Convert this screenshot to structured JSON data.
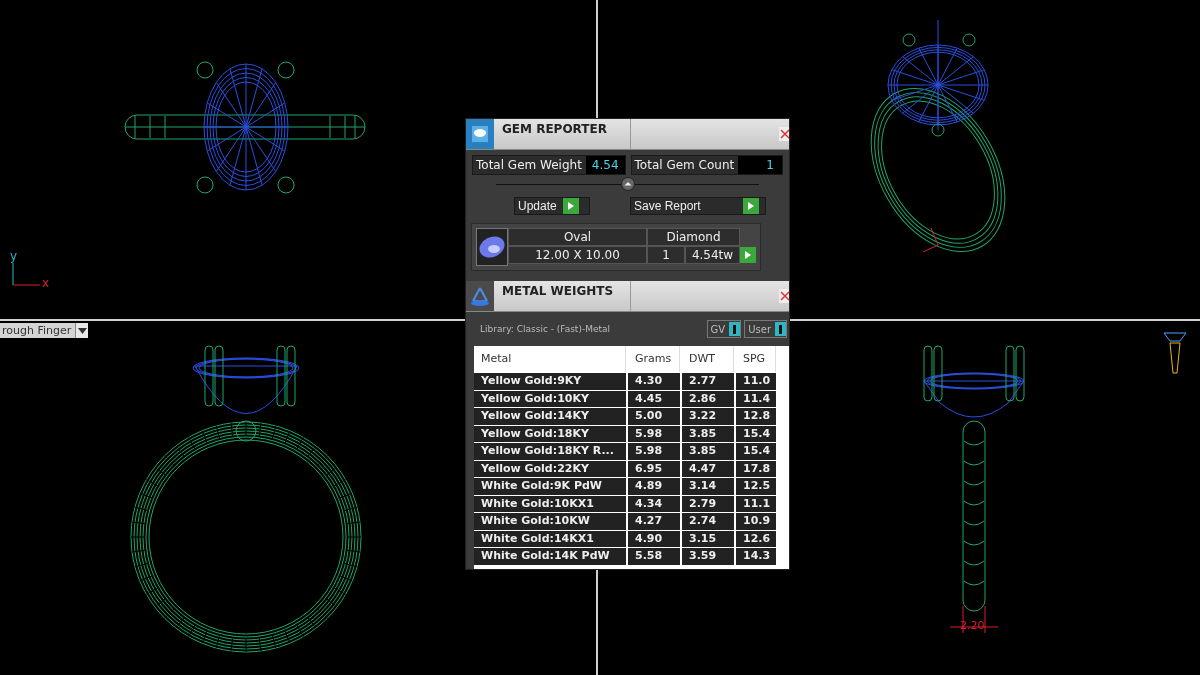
{
  "viewports": [
    {
      "kind": "top",
      "axis_labels": [
        "y",
        "x"
      ]
    },
    {
      "kind": "perspective"
    },
    {
      "kind": "front",
      "view_menu": "rough Finger"
    },
    {
      "kind": "side",
      "dimension": "2.20"
    }
  ],
  "gem_reporter": {
    "title": "GEM REPORTER",
    "total_weight": {
      "label": "Total Gem Weight",
      "value": "4.54"
    },
    "total_count": {
      "label": "Total Gem Count",
      "value": "1"
    },
    "buttons": [
      "Update",
      "Save Report"
    ],
    "gem": {
      "shape": "Oval",
      "type": "Diamond",
      "size": "12.00 X 10.00",
      "count": "1",
      "weight": "4.54tw"
    }
  },
  "metal_weights": {
    "title": "METAL WEIGHTS",
    "library": "Library: Classic - (Fast)-Metal",
    "toggles": [
      {
        "label": "GV",
        "on": true
      },
      {
        "label": "User",
        "on": true
      }
    ],
    "columns": [
      "Metal",
      "Grams",
      "DWT",
      "SPG"
    ],
    "rows": [
      [
        "Yellow Gold:9KY",
        "4.30",
        "2.77",
        "11.0"
      ],
      [
        "Yellow Gold:10KY",
        "4.45",
        "2.86",
        "11.4"
      ],
      [
        "Yellow Gold:14KY",
        "5.00",
        "3.22",
        "12.8"
      ],
      [
        "Yellow Gold:18KY",
        "5.98",
        "3.85",
        "15.4"
      ],
      [
        "Yellow Gold:18KY R...",
        "5.98",
        "3.85",
        "15.4"
      ],
      [
        "Yellow Gold:22KY",
        "6.95",
        "4.47",
        "17.8"
      ],
      [
        "White Gold:9K PdW",
        "4.89",
        "3.14",
        "12.5"
      ],
      [
        "White Gold:10KX1",
        "4.34",
        "2.79",
        "11.1"
      ],
      [
        "White Gold:10KW",
        "4.27",
        "2.74",
        "10.9"
      ],
      [
        "White Gold:14KX1",
        "4.90",
        "3.15",
        "12.6"
      ],
      [
        "White Gold:14K PdW",
        "5.58",
        "3.59",
        "14.3"
      ]
    ]
  }
}
